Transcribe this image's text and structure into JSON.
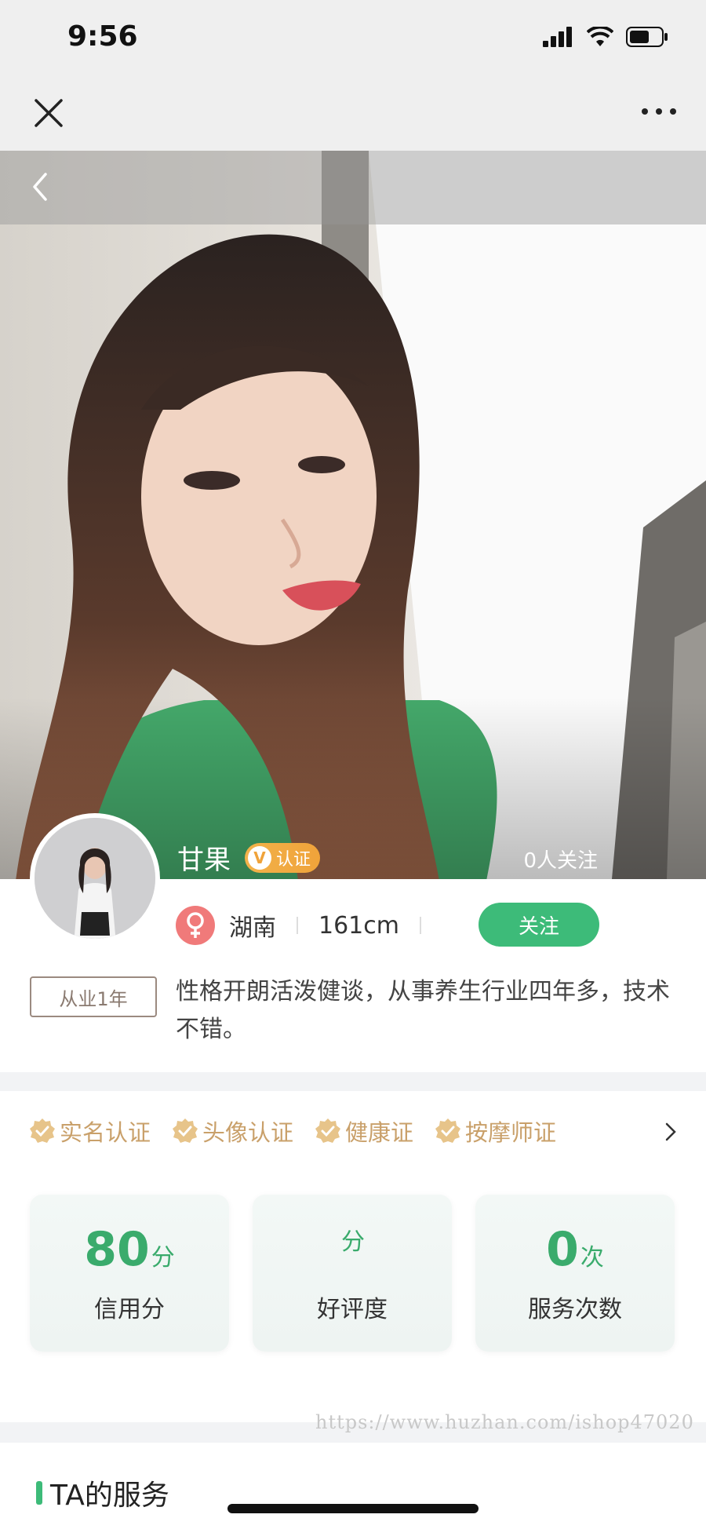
{
  "status_bar": {
    "time": "9:56"
  },
  "profile": {
    "name": "甘果",
    "verify_badge": "认证",
    "followers": "0人关注",
    "region": "湖南",
    "height": "161cm",
    "follow_button": "关注",
    "experience_tag": "从业1年",
    "bio": "性格开朗活泼健谈，从事养生行业四年多，技术不错。"
  },
  "certifications": [
    {
      "label": "实名认证",
      "icon": "badge-check-icon"
    },
    {
      "label": "头像认证",
      "icon": "badge-check-icon"
    },
    {
      "label": "健康证",
      "icon": "badge-check-icon"
    },
    {
      "label": "按摩师证",
      "icon": "badge-check-icon"
    }
  ],
  "stats": [
    {
      "value": "80",
      "unit": "分",
      "label": "信用分"
    },
    {
      "value": "",
      "unit": "分",
      "label": "好评度"
    },
    {
      "value": "0",
      "unit": "次",
      "label": "服务次数"
    }
  ],
  "watermark": "https://www.huzhan.com/ishop47020",
  "services_section": {
    "title": "TA的服务"
  },
  "colors": {
    "accent_green": "#3dbb79",
    "gold": "#c9a06a",
    "female_pink": "#f07a7a"
  }
}
